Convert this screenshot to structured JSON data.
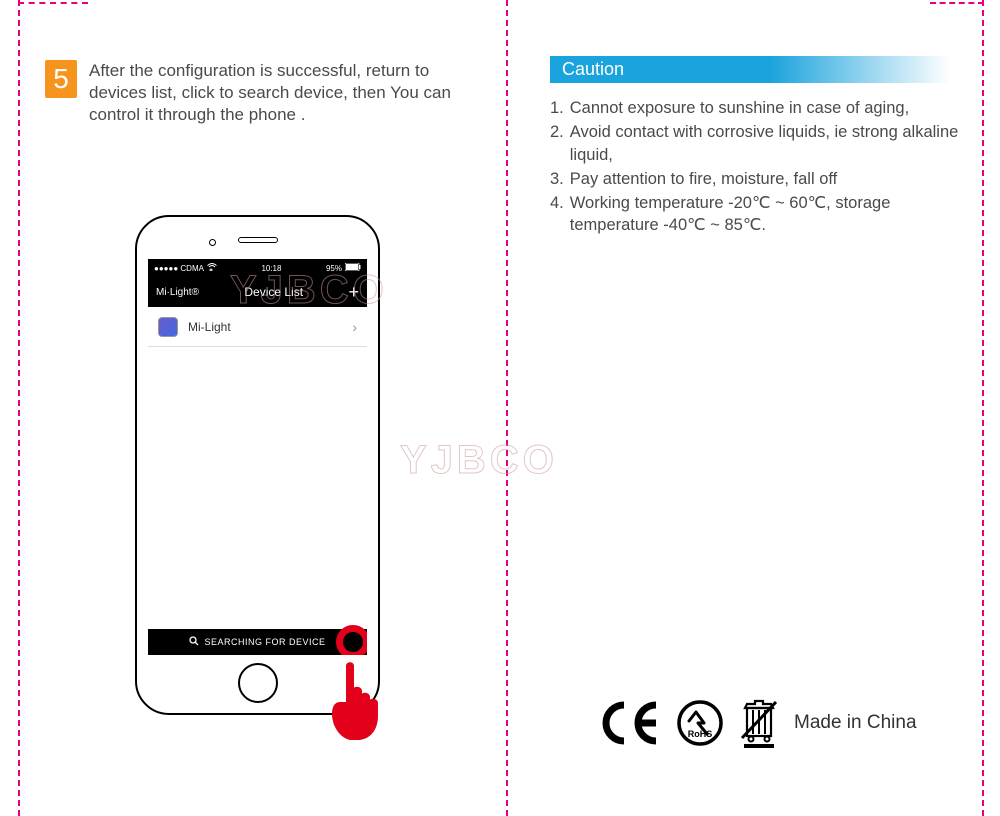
{
  "step": {
    "number": "5",
    "text": "After the configuration is successful, return to devices list, click to search device, then You can control it through the phone ."
  },
  "phone": {
    "status": {
      "carrier": "●●●●● CDMA",
      "wifi": "wifi-icon",
      "time": "10:18",
      "battery_pct": "95%"
    },
    "nav": {
      "brand": "Mi·Light®",
      "title": "Device List",
      "add": "+"
    },
    "device_item": {
      "name": "Mi-Light",
      "chevron": "›"
    },
    "search_label": "SEARCHING FOR DEVICE"
  },
  "caution": {
    "heading": "Caution",
    "items": [
      "Cannot exposure to sunshine in case of aging,",
      "Avoid contact with corrosive liquids, ie strong alkaline liquid,",
      "Pay attention to fire, moisture, fall off",
      "Working temperature -20℃ ~ 60℃, storage temperature -40℃ ~ 85℃."
    ]
  },
  "cert": {
    "made_in": "Made in China",
    "rohs": "RoHS"
  },
  "watermark": "YJBCO"
}
